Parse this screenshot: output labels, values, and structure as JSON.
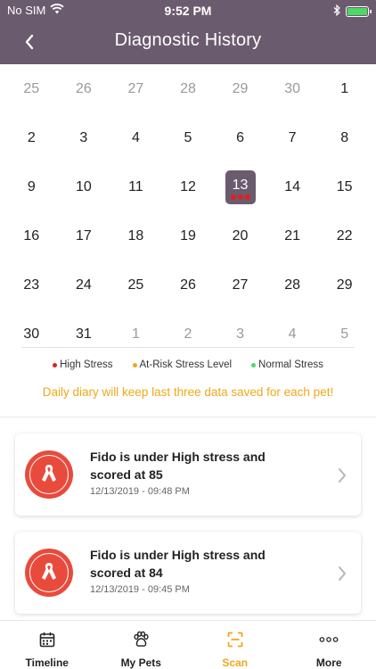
{
  "status_bar": {
    "carrier": "No SIM",
    "time": "9:52 PM"
  },
  "header": {
    "title": "Diagnostic History"
  },
  "colors": {
    "header_bg": "#6b5b6e",
    "high_stress": "#e0201a",
    "at_risk": "#f0a818",
    "normal": "#4cd964",
    "accent": "#f0a818",
    "card_icon_bg": "#e84b3c"
  },
  "calendar": {
    "weeks": [
      [
        {
          "d": "25",
          "m": true
        },
        {
          "d": "26",
          "m": true
        },
        {
          "d": "27",
          "m": true
        },
        {
          "d": "28",
          "m": true
        },
        {
          "d": "29",
          "m": true
        },
        {
          "d": "30",
          "m": true
        },
        {
          "d": "1",
          "m": false
        }
      ],
      [
        {
          "d": "2",
          "m": false
        },
        {
          "d": "3",
          "m": false
        },
        {
          "d": "4",
          "m": false
        },
        {
          "d": "5",
          "m": false
        },
        {
          "d": "6",
          "m": false
        },
        {
          "d": "7",
          "m": false
        },
        {
          "d": "8",
          "m": false
        }
      ],
      [
        {
          "d": "9",
          "m": false
        },
        {
          "d": "10",
          "m": false
        },
        {
          "d": "11",
          "m": false
        },
        {
          "d": "12",
          "m": false
        },
        {
          "d": "13",
          "m": false,
          "selected": true,
          "dots": [
            "high",
            "high",
            "high"
          ]
        },
        {
          "d": "14",
          "m": false
        },
        {
          "d": "15",
          "m": false
        }
      ],
      [
        {
          "d": "16",
          "m": false
        },
        {
          "d": "17",
          "m": false
        },
        {
          "d": "18",
          "m": false
        },
        {
          "d": "19",
          "m": false
        },
        {
          "d": "20",
          "m": false
        },
        {
          "d": "21",
          "m": false
        },
        {
          "d": "22",
          "m": false
        }
      ],
      [
        {
          "d": "23",
          "m": false
        },
        {
          "d": "24",
          "m": false
        },
        {
          "d": "25",
          "m": false
        },
        {
          "d": "26",
          "m": false
        },
        {
          "d": "27",
          "m": false
        },
        {
          "d": "28",
          "m": false
        },
        {
          "d": "29",
          "m": false
        }
      ],
      [
        {
          "d": "30",
          "m": false
        },
        {
          "d": "31",
          "m": false
        },
        {
          "d": "1",
          "m": true
        },
        {
          "d": "2",
          "m": true
        },
        {
          "d": "3",
          "m": true
        },
        {
          "d": "4",
          "m": true
        },
        {
          "d": "5",
          "m": true
        }
      ]
    ]
  },
  "legend": {
    "high": "High Stress",
    "at_risk": "At-Risk Stress Level",
    "normal": "Normal Stress"
  },
  "diary_note": "Daily diary will keep last three data saved for each pet!",
  "records": [
    {
      "title": "Fido is under High stress and scored at 85",
      "timestamp": "12/13/2019 - 09:48 PM",
      "icon": "awareness-ribbon-icon"
    },
    {
      "title": "Fido is under High stress and scored at 84",
      "timestamp": "12/13/2019 - 09:45 PM",
      "icon": "awareness-ribbon-icon"
    }
  ],
  "tabs": [
    {
      "label": "Timeline",
      "icon": "calendar-icon",
      "active": false
    },
    {
      "label": "My Pets",
      "icon": "paw-icon",
      "active": false
    },
    {
      "label": "Scan",
      "icon": "scan-icon",
      "active": true
    },
    {
      "label": "More",
      "icon": "more-dots-icon",
      "active": false
    }
  ]
}
